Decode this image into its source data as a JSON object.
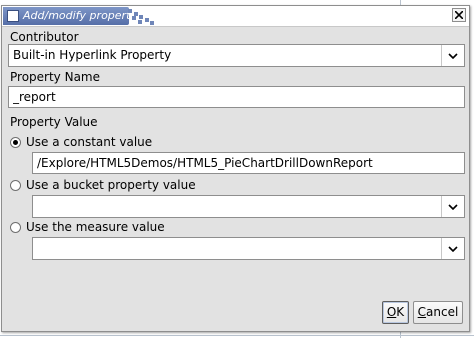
{
  "dialog": {
    "title": "Add/modify property"
  },
  "contributor": {
    "label": "Contributor",
    "selected": "Built-in Hyperlink Property"
  },
  "property_name": {
    "label": "Property Name",
    "value": "_report"
  },
  "property_value": {
    "label": "Property Value",
    "options": [
      {
        "label": "Use a constant value",
        "selected": true
      },
      {
        "label": "Use a bucket property value",
        "selected": false
      },
      {
        "label": "Use the measure value",
        "selected": false
      }
    ],
    "constant_value": "/Explore/HTML5Demos/HTML5_PieChartDrillDownReport",
    "bucket_selected": "",
    "measure_selected": ""
  },
  "buttons": {
    "ok_mnemonic": "O",
    "ok_rest": "K",
    "cancel_mnemonic": "C",
    "cancel_rest": "ancel"
  },
  "icons": {
    "title": "window-icon",
    "close": "close-icon",
    "dropdown": "chevron-down-icon"
  },
  "colors": {
    "title_bar": "#566fa8",
    "dialog_bg": "#e2e2e2",
    "border": "#8e8e8e"
  }
}
